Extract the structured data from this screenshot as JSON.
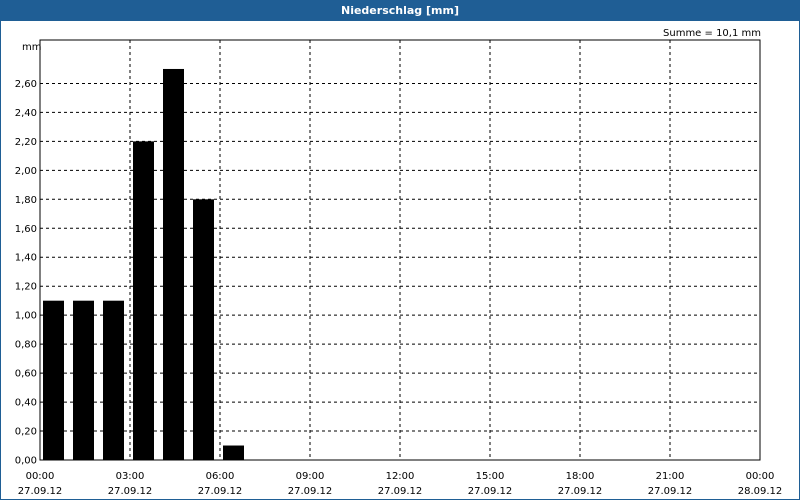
{
  "window": {
    "title": "Niederschlag [mm]"
  },
  "chart_data": {
    "type": "bar",
    "title": "Niederschlag [mm]",
    "ylabel": "mm",
    "xlabel": "",
    "summary": "Summe = 10,1 mm",
    "ylim": [
      0,
      2.9
    ],
    "yticks": [
      0,
      0.2,
      0.4,
      0.6,
      0.8,
      1.0,
      1.2,
      1.4,
      1.6,
      1.8,
      2.0,
      2.2,
      2.4,
      2.6
    ],
    "ytick_labels": [
      "0,00",
      "0,20",
      "0,40",
      "0,60",
      "0,80",
      "1,00",
      "1,20",
      "1,40",
      "1,60",
      "1,80",
      "2,00",
      "2,20",
      "2,40",
      "2,60"
    ],
    "xlim_hours": [
      0,
      24
    ],
    "xticks": [
      {
        "time": "00:00",
        "date": "27.09.12"
      },
      {
        "time": "03:00",
        "date": "27.09.12"
      },
      {
        "time": "06:00",
        "date": "27.09.12"
      },
      {
        "time": "09:00",
        "date": "27.09.12"
      },
      {
        "time": "12:00",
        "date": "27.09.12"
      },
      {
        "time": "15:00",
        "date": "27.09.12"
      },
      {
        "time": "18:00",
        "date": "27.09.12"
      },
      {
        "time": "21:00",
        "date": "27.09.12"
      },
      {
        "time": "00:00",
        "date": "28.09.12"
      }
    ],
    "bars": [
      {
        "time": "00:00",
        "value": 1.1
      },
      {
        "time": "01:00",
        "value": 1.1
      },
      {
        "time": "02:00",
        "value": 1.1
      },
      {
        "time": "03:00",
        "value": 2.2
      },
      {
        "time": "04:00",
        "value": 2.7
      },
      {
        "time": "05:00",
        "value": 1.8
      },
      {
        "time": "06:00",
        "value": 0.1
      }
    ],
    "bar_color": "#000000",
    "grid": true
  }
}
